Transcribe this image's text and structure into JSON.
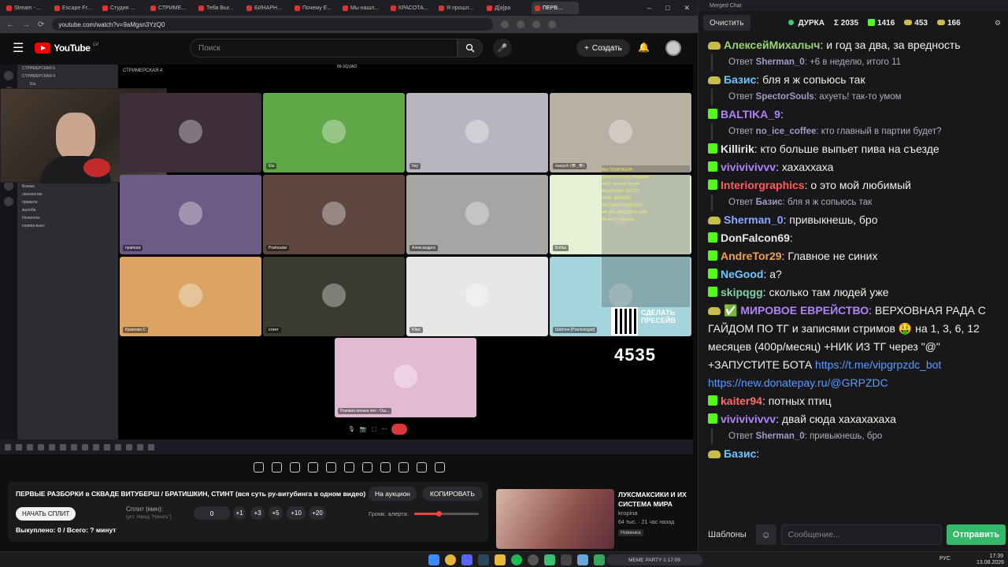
{
  "browser": {
    "tabs": [
      "Stream - ...",
      "Escape Fr...",
      "Студия ...",
      "СТРИМЕ...",
      "Тебя Выг...",
      "БИНАРН...",
      "Почему Е...",
      "Мы нашл...",
      "КРАСОТА...",
      "Я прошл...",
      "Д[а]ра",
      "ПЕРВ..."
    ],
    "url": "youtube.com/watch?v=9aMgsn3YzQ0"
  },
  "youtube": {
    "logo_text": "YouTube",
    "region": "LV",
    "search_placeholder": "Поиск",
    "create_label": "Создать"
  },
  "video": {
    "discord_channels": [
      "СТРИМЕРСКАЯ 5",
      "СТРИМЕРСКАЯ 4",
      "Ela",
      "hey",
      "masych (👁_👁)",
      "nyamura",
      "Pramoutar",
      "Александрос",
      "Бобка 🐊",
      "Кукиняка С",
      "стинт",
      "Юви",
      "Шаблон [Pramlologist]",
      "Розовая пинька чип - Ош...",
      "ЗАНЯТО (НЕ ВХОДИТЬ БЛЯТЬ)",
      "Бомжи",
      "лингвистик",
      "правила",
      "жалоба",
      "Нелиотин",
      "сервер-выкс"
    ],
    "call_title": "СТРИМЕРСКАЯ 4",
    "server_name": "89-SQUAD",
    "tiles": [
      {
        "label": "",
        "color": "#3d2e3a"
      },
      {
        "label": "Ela",
        "color": "#5fa848"
      },
      {
        "label": "hey",
        "color": "#b7b5bf"
      },
      {
        "label": "masych (👁_👁)",
        "color": "#b9b0a4"
      },
      {
        "label": "nyamura",
        "color": "#6d5a86"
      },
      {
        "label": "Pramoutar",
        "color": "#5e4741"
      },
      {
        "label": "Александрос",
        "color": "#a7a5a3"
      },
      {
        "label": "Бобка",
        "color": "#e6f0d4"
      },
      {
        "label": "Кукиняка С",
        "color": "#dba463"
      },
      {
        "label": "стинт",
        "color": "#3b3b32"
      },
      {
        "label": "Юви",
        "color": "#e7e7e7"
      },
      {
        "label": "Шаблон [Pramlologist]",
        "color": "#a6d4dc"
      },
      {
        "label": "Розовая пинька чип - Ош...",
        "color": "#e2bad3"
      }
    ],
    "overlay_lines": [
      "МЫ ПОМОЖЕМ!",
      "Дарк с нолстуна пуденкам",
      "ответ на кому играет",
      "abeka23421: ЖЕСТЬ",
      "♥ЯКА: ВКЛЮЧИ",
      "ЗАХОДИЛ СЮДА БЛЯ",
      "АА ЗАЕ ЗАХОДИТЬ БЛЯ",
      "ой же тут человек"
    ],
    "qr_caption": "СДЕЛАТЬ ПРЕСЕЙВ",
    "viewer_count": "4535"
  },
  "panel": {
    "title": "ПЕРВЫЕ РАЗБОРКИ в СКВАДЕ ВИТУБЕРШ / БРАТИШКИН, СТИНТ (вся суть ру-витубинга в одном видео)",
    "auction_btn": "На аукцион",
    "copy_btn": "КОПИРОВАТЬ",
    "start_split": "НАЧАТЬ СПЛИТ",
    "split_label": "Сплит (мин):",
    "split_sub": "(уст. перед \"Начать\")",
    "split_value": "0",
    "add_buttons": [
      "+1",
      "+3",
      "+5",
      "+10",
      "+20"
    ],
    "volume_label": "Громк. алерта:",
    "volume_level": 0.38,
    "bought": "Выкуплено: 0 / Всего: ? минут"
  },
  "recommendation": {
    "title": "ЛУКСМАКСИКИ И ИХ СИСТЕМА МИРА",
    "channel": "kropina",
    "stats": "64 тыс. · 21 час назад",
    "badge": "Новинка"
  },
  "chat": {
    "window_title": "Merged Chat",
    "clear_btn": "Очистить",
    "stats": {
      "user": "ДУРКА",
      "sum": "Σ 2035",
      "kick": "1416",
      "yt": "453",
      "other": "166"
    },
    "messages": [
      {
        "type": "msg",
        "platform": "yt",
        "user": "АлексейМихалыч",
        "color": "#9bd36f",
        "text": ": и год за два, за вредность"
      },
      {
        "type": "reply",
        "reply_user": "Sherman_0",
        "text": ": +6 в неделю, итого 11"
      },
      {
        "type": "msg",
        "platform": "yt",
        "user": "Базис",
        "color": "#6ec6ff",
        "text": ": бля я ж сопьюсь так"
      },
      {
        "type": "reply",
        "reply_user": "SpectorSouls",
        "text": ": ахуеть! так-то умом"
      },
      {
        "type": "msg",
        "platform": "kick",
        "user": "BALTIKA_9",
        "color": "#b084f5",
        "text": ":"
      },
      {
        "type": "reply",
        "reply_user": "no_ice_coffee",
        "text": ": кто главный в партии будет?"
      },
      {
        "type": "msg",
        "platform": "kick",
        "user": "Killirik",
        "color": "#e8e8e8",
        "text": ": кто больше выпьет пива на съезде"
      },
      {
        "type": "msg",
        "platform": "kick",
        "user": "vivivivivvv",
        "color": "#b084f5",
        "text": ": хахаххаха"
      },
      {
        "type": "msg",
        "platform": "kick",
        "user": "Interiorgraphics",
        "color": "#ff5c5c",
        "text": ": о это мой любимый"
      },
      {
        "type": "reply",
        "reply_user": "Базис",
        "text": ": бля я ж сопьюсь так"
      },
      {
        "type": "msg",
        "platform": "yt",
        "user": "Sherman_0",
        "color": "#8aa8ff",
        "text": ": привыкнешь, бро"
      },
      {
        "type": "msg",
        "platform": "kick",
        "user": "DonFalcon69",
        "color": "#e8e8e8",
        "text": ":"
      },
      {
        "type": "msg",
        "platform": "kick",
        "user": "AndreTor29",
        "color": "#f0a04b",
        "text": ": Главное не синих"
      },
      {
        "type": "msg",
        "platform": "kick",
        "user": "NeGood",
        "color": "#6ec6ff",
        "text": ": а?"
      },
      {
        "type": "msg",
        "platform": "kick",
        "user": "skipqgg",
        "color": "#7fd4a8",
        "text": ": сколько там людей уже"
      },
      {
        "type": "msg",
        "platform": "yt",
        "user": "✅ МИРОВОЕ ЕВРЕЙСТВО",
        "color": "#b084f5",
        "text": ": ВЕРХОВНАЯ РАДА С ГАЙДОМ ПО ТГ и записями стримов 🤑 на 1, 3, 6, 12 месяцев (400р/месяц) +НИК ИЗ ТГ через \"@\" +ЗАПУСТИТЕ БОТА",
        "links": [
          "https://t.me/vipgrpzdc_bot",
          "https://new.donatepay.ru/@GRPZDC"
        ]
      },
      {
        "type": "msg",
        "platform": "kick",
        "user": "kaiter94",
        "color": "#ff6b6b",
        "text": ": потных птиц"
      },
      {
        "type": "msg",
        "platform": "kick",
        "user": "vivivivivvv",
        "color": "#b084f5",
        "text": ": двай сюда хахахахаха"
      },
      {
        "type": "reply",
        "reply_user": "Sherman_0",
        "text": ": привыкнешь, бро"
      },
      {
        "type": "msg",
        "platform": "yt",
        "user": "Базис",
        "color": "#6ec6ff",
        "text": ":"
      }
    ],
    "templates_btn": "Шаблоны",
    "input_placeholder": "Сообщение...",
    "send_btn": "Отправить"
  },
  "os": {
    "widget_text": "MEME PARTY 1:17:09",
    "lang": "РУС",
    "time": "17:39",
    "date": "13.08.2026"
  },
  "colors": {
    "kick": "#53fc18",
    "yt_red": "#ff0000",
    "send": "#36b86a"
  }
}
